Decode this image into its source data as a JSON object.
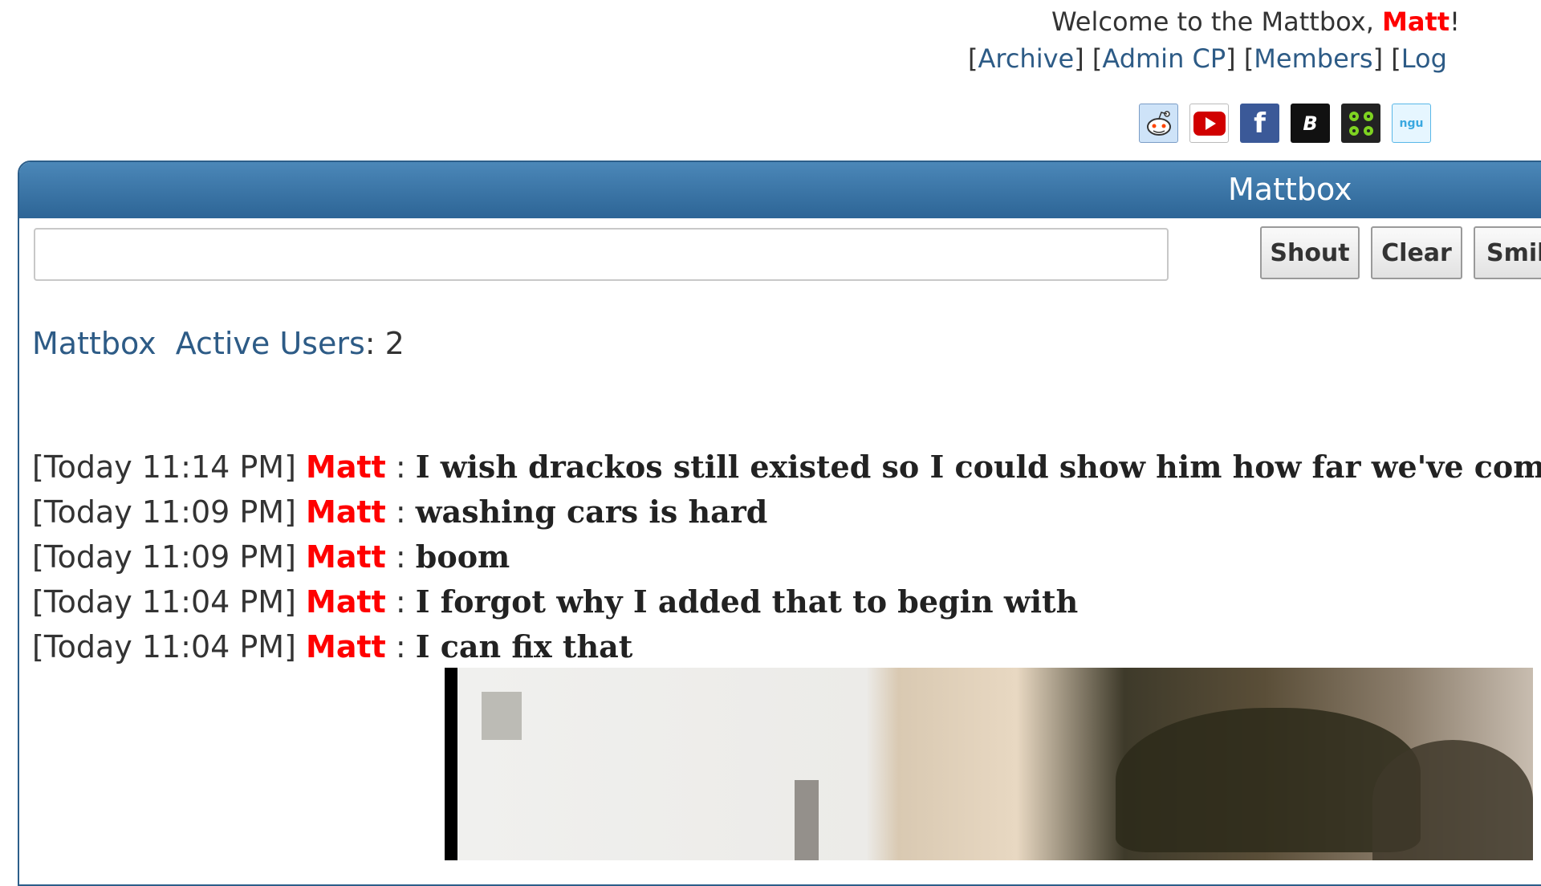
{
  "header": {
    "welcome_prefix": "Welcome to the Mattbox, ",
    "username": "Matt",
    "welcome_suffix": "!",
    "links": [
      "Archive",
      "Admin CP",
      "Members",
      "Log"
    ]
  },
  "social_icons": [
    {
      "name": "reddit-icon"
    },
    {
      "name": "youtube-icon"
    },
    {
      "name": "facebook-icon",
      "glyph": "f"
    },
    {
      "name": "b-icon",
      "glyph": "B"
    },
    {
      "name": "clover-icon"
    },
    {
      "name": "ngu-icon",
      "glyph": "ngu"
    }
  ],
  "panel": {
    "title": "Mattbox",
    "input_value": "",
    "buttons": {
      "shout": "Shout",
      "clear": "Clear",
      "smilies": "Smil"
    },
    "active": {
      "label": "Mattbox",
      "users_label": "Active Users",
      "sep": ": ",
      "count": "2"
    }
  },
  "messages": [
    {
      "time": "[Today 11:14 PM]",
      "user": "Matt",
      "text": "I wish drackos still existed so I could show him how far we've come"
    },
    {
      "time": "[Today 11:09 PM]",
      "user": "Matt",
      "text": "washing cars is hard"
    },
    {
      "time": "[Today 11:09 PM]",
      "user": "Matt",
      "text": "boom"
    },
    {
      "time": "[Today 11:04 PM]",
      "user": "Matt",
      "text": "I forgot why I added that to begin with"
    },
    {
      "time": "[Today 11:04 PM]",
      "user": "Matt",
      "text": "I can fix that"
    }
  ],
  "colors": {
    "accent_blue": "#2d6596",
    "username_red": "#ff0000",
    "link_blue": "#2d5b86"
  }
}
